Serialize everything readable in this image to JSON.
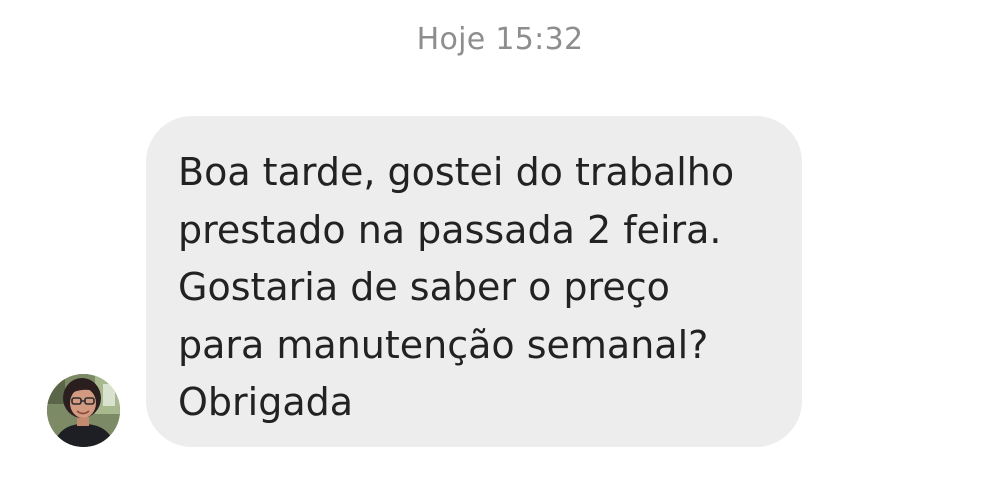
{
  "conversation": {
    "timestamp": "Hoje 15:32",
    "message": {
      "lines": [
        "Boa tarde, gostei do trabalho",
        "prestado na passada 2 feira.",
        "Gostaria de saber o preço",
        "para manutenção semanal?",
        "Obrigada"
      ]
    },
    "sender": {
      "avatar_icon": "user-photo-avatar"
    }
  },
  "colors": {
    "bubble_background": "#ededed",
    "message_text": "#222222",
    "timestamp_text": "#8e8e8e",
    "page_background": "#ffffff"
  }
}
